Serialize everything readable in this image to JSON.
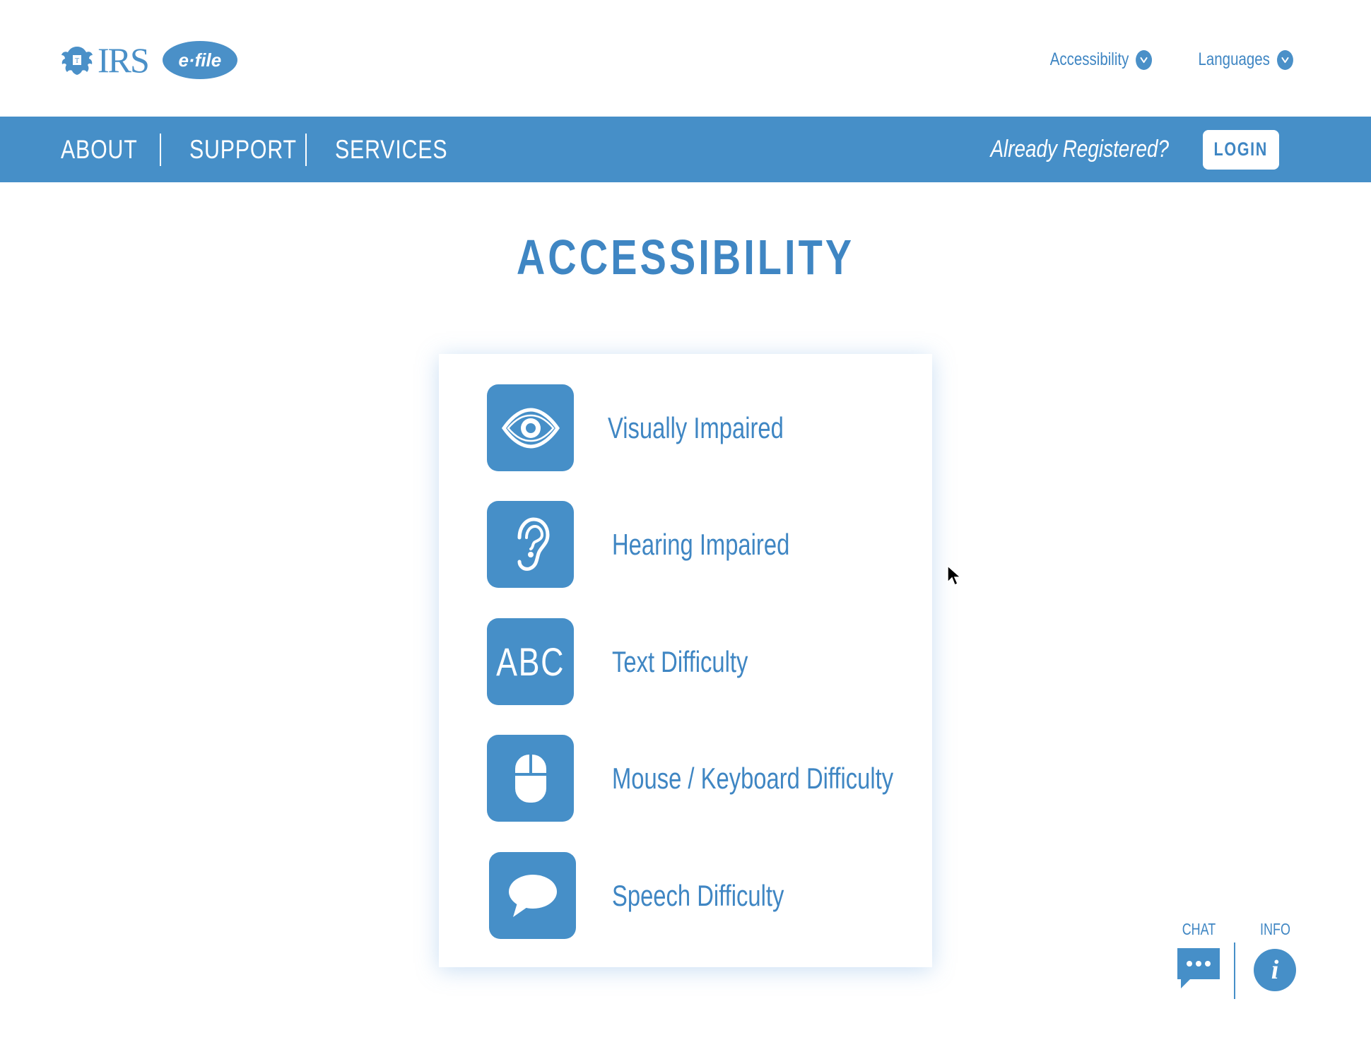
{
  "header": {
    "brand_text": "IRS",
    "efile_text": "e·file",
    "top_menus": [
      {
        "label": "Accessibility"
      },
      {
        "label": "Languages"
      }
    ]
  },
  "nav": {
    "links": [
      {
        "label": "ABOUT"
      },
      {
        "label": "SUPPORT"
      },
      {
        "label": "SERVICES"
      }
    ],
    "already_registered": "Already Registered?",
    "login_label": "LOGIN"
  },
  "page_title": "ACCESSIBILITY",
  "options": [
    {
      "label": "Visually Impaired",
      "icon": "eye-icon"
    },
    {
      "label": "Hearing Impaired",
      "icon": "ear-icon"
    },
    {
      "label": "Text Difficulty",
      "icon": "abc-icon",
      "icon_text": "ABC"
    },
    {
      "label": "Mouse / Keyboard Difficulty",
      "icon": "mouse-icon"
    },
    {
      "label": "Speech Difficulty",
      "icon": "speech-bubble-icon"
    }
  ],
  "helpers": {
    "chat_label": "CHAT",
    "info_label": "INFO",
    "info_glyph": "i"
  },
  "colors": {
    "accent": "#468fc8",
    "text_accent": "#3f86c3",
    "background": "#ffffff"
  }
}
